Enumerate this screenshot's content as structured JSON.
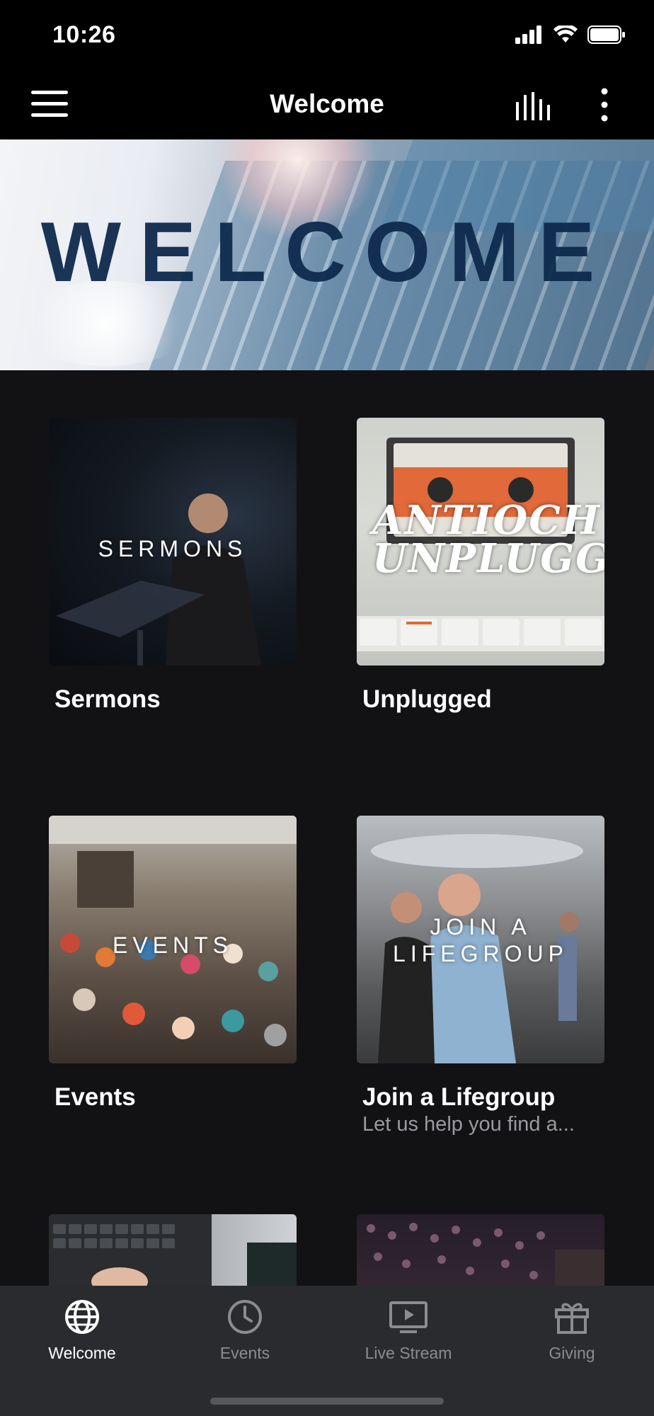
{
  "status_bar": {
    "time": "10:26"
  },
  "nav": {
    "title": "Welcome"
  },
  "hero": {
    "text": "WELCOME"
  },
  "tiles": [
    {
      "overlay": "SERMONS",
      "title": "Sermons",
      "subtitle": ""
    },
    {
      "overlay": "ANTIOCH UNPLUGGED",
      "title": "Unplugged",
      "subtitle": ""
    },
    {
      "overlay": "EVENTS",
      "title": "Events",
      "subtitle": ""
    },
    {
      "overlay_line1": "JOIN A",
      "overlay_line2": "LIFEGROUP",
      "title": "Join a Lifegroup",
      "subtitle": "Let us help you find a..."
    }
  ],
  "tab_bar": {
    "items": [
      {
        "label": "Welcome",
        "icon": "globe-icon",
        "active": true
      },
      {
        "label": "Events",
        "icon": "clock-icon",
        "active": false
      },
      {
        "label": "Live Stream",
        "icon": "play-screen-icon",
        "active": false
      },
      {
        "label": "Giving",
        "icon": "gift-icon",
        "active": false
      }
    ]
  },
  "colors": {
    "background": "#121215",
    "tab_bar": "#2a2b2e",
    "inactive_tab": "#8b8c90",
    "hero_text": "#0e2a4d"
  }
}
